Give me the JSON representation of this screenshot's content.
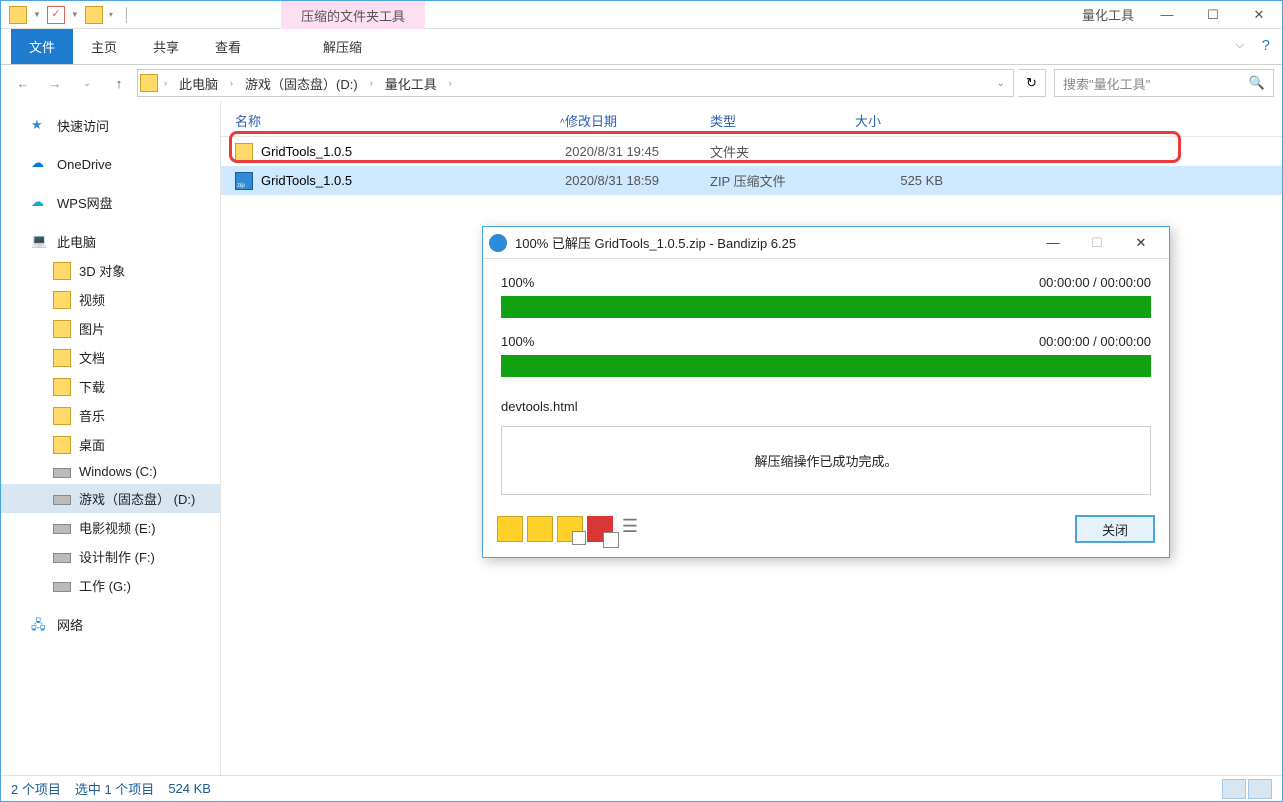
{
  "titlebar": {
    "context_tab": "压缩的文件夹工具",
    "window_title": "量化工具"
  },
  "ribbon": {
    "file": "文件",
    "home": "主页",
    "share": "共享",
    "view": "查看",
    "extract": "解压缩"
  },
  "breadcrumb": {
    "pc": "此电脑",
    "drive": "游戏（固态盘）(D:)",
    "folder": "量化工具"
  },
  "search": {
    "placeholder": "搜索\"量化工具\""
  },
  "columns": {
    "name": "名称",
    "date": "修改日期",
    "type": "类型",
    "size": "大小"
  },
  "rows": [
    {
      "name": "GridTools_1.0.5",
      "date": "2020/8/31 19:45",
      "type": "文件夹",
      "size": "",
      "icon": "folder"
    },
    {
      "name": "GridTools_1.0.5",
      "date": "2020/8/31 18:59",
      "type": "ZIP 压缩文件",
      "size": "525 KB",
      "icon": "zip"
    }
  ],
  "sidebar": {
    "quick": "快速访问",
    "onedrive": "OneDrive",
    "wps": "WPS网盘",
    "pc": "此电脑",
    "obj3d": "3D 对象",
    "video": "视频",
    "pictures": "图片",
    "docs": "文档",
    "downloads": "下载",
    "music": "音乐",
    "desktop": "桌面",
    "c": "Windows (C:)",
    "d": "游戏（固态盘） (D:)",
    "e": "电影视频 (E:)",
    "f": "设计制作 (F:)",
    "g": "工作 (G:)",
    "network": "网络"
  },
  "status": {
    "count": "2 个项目",
    "selected": "选中 1 个项目",
    "size": "524 KB"
  },
  "dialog": {
    "title": "100% 已解压 GridTools_1.0.5.zip - Bandizip 6.25",
    "percent1": "100%",
    "time1": "00:00:00 / 00:00:00",
    "percent2": "100%",
    "time2": "00:00:00 / 00:00:00",
    "filename": "devtools.html",
    "message": "解压缩操作已成功完成。",
    "close": "关闭"
  }
}
